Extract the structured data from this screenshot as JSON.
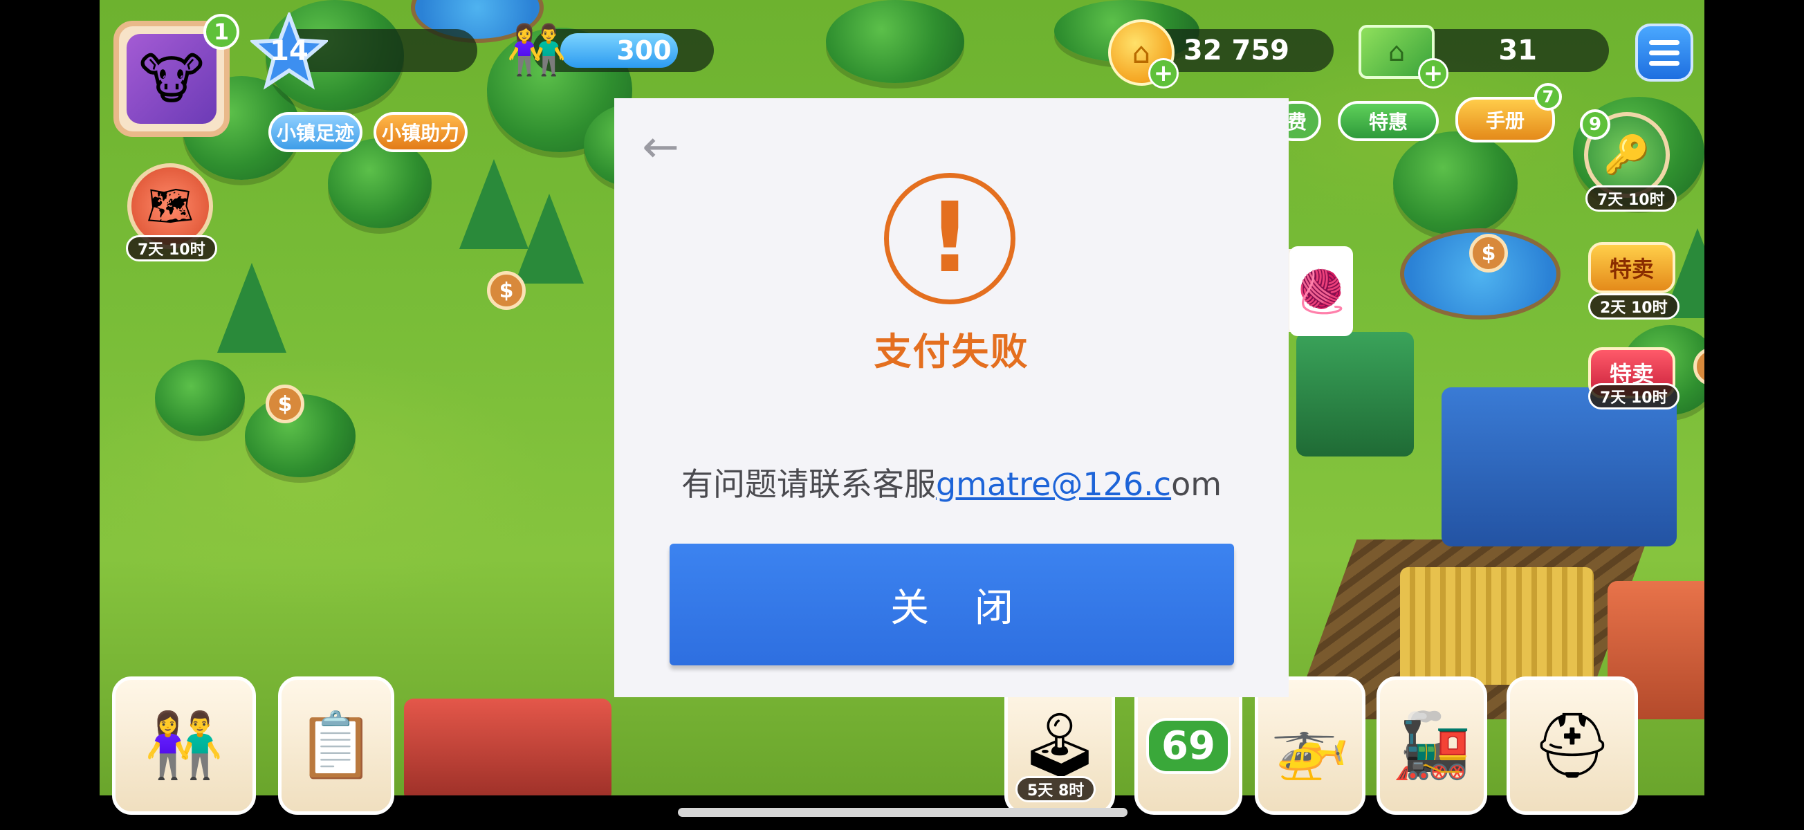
{
  "hud": {
    "avatar_badge": "1",
    "level": "14",
    "population": "300",
    "coins": "32 759",
    "cash": "31",
    "tabs": [
      "小镇足迹",
      "小镇助力"
    ],
    "shop_tabs": [
      "费",
      "特惠",
      "手册"
    ],
    "manual_badge": "7",
    "key_badge": "9",
    "icons": {
      "avatar": "cow-avatar-icon",
      "level": "star-icon",
      "population": "people-icon",
      "coins": "coin-icon",
      "cash": "cash-icon",
      "menu": "hamburger-menu-icon"
    }
  },
  "events": {
    "treasure_map_timer": "7天 10时",
    "key_timer": "7天 10时",
    "sale1_label": "特卖",
    "sale1_timer": "2天 10时",
    "sale2_label": "特卖",
    "sale2_timer": "7天 10时"
  },
  "bottom_bar": {
    "tasks_timer": "5天 8时",
    "level_badge": "69"
  },
  "dialog": {
    "back_icon": "back-arrow-icon",
    "status_icon": "exclamation-icon",
    "title": "支付失败",
    "contact_prefix": "有问题请联系客服",
    "contact_email_link": "gmatre@126.c",
    "contact_email_suffix": "om",
    "close_label": "关 闭"
  },
  "colors": {
    "warning": "#e46f1f",
    "button": "#2e6fe0",
    "link": "#1d64d8"
  }
}
